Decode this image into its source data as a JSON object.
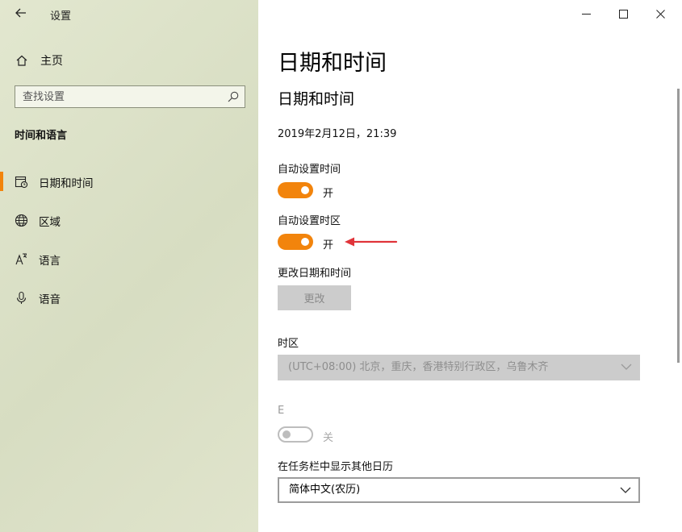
{
  "window": {
    "app_title": "设置",
    "controls": [
      "minimize-icon",
      "maximize-icon",
      "close-icon"
    ]
  },
  "sidebar": {
    "home_label": "主页",
    "search_placeholder": "查找设置",
    "section_heading": "时间和语言",
    "items": [
      {
        "label": "日期和时间",
        "icon": "calendar-clock-icon",
        "selected": true
      },
      {
        "label": "区域",
        "icon": "globe-icon",
        "selected": false
      },
      {
        "label": "语言",
        "icon": "language-icon",
        "selected": false
      },
      {
        "label": "语音",
        "icon": "microphone-icon",
        "selected": false
      }
    ]
  },
  "main": {
    "page_title": "日期和时间",
    "section_title": "日期和时间",
    "current_datetime": "2019年2月12日，21:39",
    "auto_time": {
      "label": "自动设置时间",
      "state": "开",
      "on": true
    },
    "auto_timezone": {
      "label": "自动设置时区",
      "state": "开",
      "on": true
    },
    "change_datetime": {
      "label": "更改日期和时间",
      "button": "更改"
    },
    "timezone": {
      "label": "时区",
      "value": "(UTC+08:00) 北京，重庆，香港特别行政区，乌鲁木齐"
    },
    "dst": {
      "label": "E",
      "state": "关",
      "on": false
    },
    "calendar": {
      "label": "在任务栏中显示其他日历",
      "value": "简体中文(农历)"
    }
  },
  "colors": {
    "accent": "#f2840c",
    "sidebar_bg": "#dbe0c7",
    "annotation_arrow": "#e0343a",
    "disabled_bg": "#cccccc"
  }
}
